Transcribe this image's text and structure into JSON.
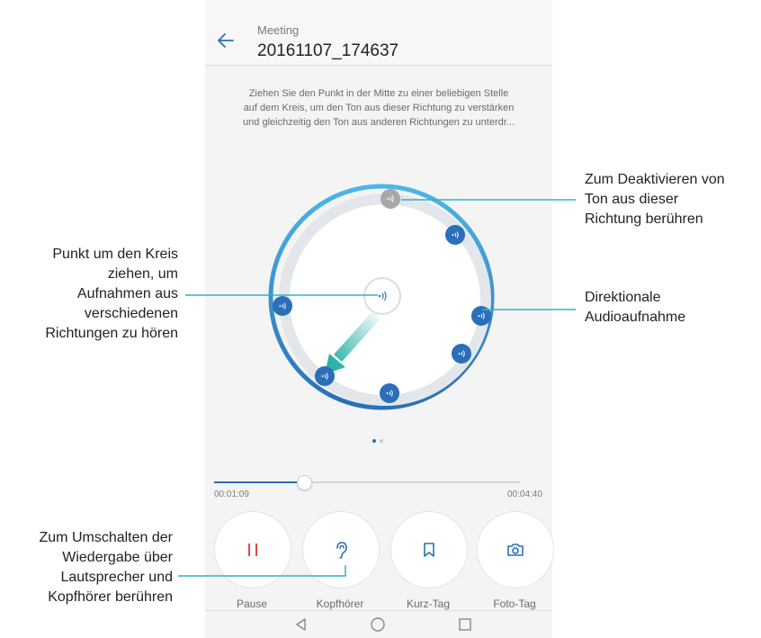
{
  "header": {
    "subtitle": "Meeting",
    "title": "20161107_174637"
  },
  "hint_lines": [
    "Ziehen Sie den Punkt in der Mitte zu einer beliebigen Stelle",
    "auf dem Kreis, um den Ton aus dieser Richtung zu verstärken",
    "und gleichzeitig den Ton aus anderen Richtungen zu unterdr..."
  ],
  "playback": {
    "elapsed": "00:01:09",
    "total": "00:04:40",
    "progress_fraction": 0.29
  },
  "controls": [
    {
      "label": "Pause",
      "icon": "pause-icon"
    },
    {
      "label": "Kopfhörer",
      "icon": "ear-icon"
    },
    {
      "label": "Kurz-Tag",
      "icon": "bookmark-icon"
    },
    {
      "label": "Foto-Tag",
      "icon": "camera-icon"
    }
  ],
  "nav": [
    "back-triangle-icon",
    "home-circle-icon",
    "recents-square-icon"
  ],
  "callouts": {
    "deactivate": [
      "Zum Deaktivieren von",
      "Ton aus dieser",
      "Richtung berühren"
    ],
    "drag": [
      "Punkt um den Kreis",
      "ziehen, um",
      "Aufnahmen aus",
      "verschiedenen",
      "Richtungen zu hören"
    ],
    "directional": [
      "Direktionale",
      "Audioaufnahme"
    ],
    "switch": [
      "Zum Umschalten der",
      "Wiedergabe über",
      "Lautsprecher und",
      "Kopfhörer berühren"
    ]
  },
  "colors": {
    "accent": "#2a6fb7",
    "ring": "#3aa3dc",
    "arrow": "#3fb8b0",
    "pause_red": "#e8473f",
    "callout_line": "#2fb3c5"
  }
}
